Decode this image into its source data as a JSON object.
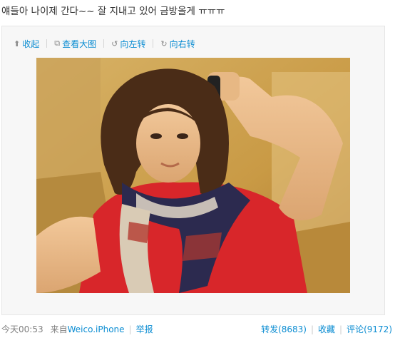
{
  "post": {
    "text": "얘들아 나이제 간다~~ 잘 지내고 있어 금방올게 ㅠㅠㅠ"
  },
  "toolbar": {
    "collapse_label": "收起",
    "view_large_label": "查看大图",
    "rotate_left_label": "向左转",
    "rotate_right_label": "向右转"
  },
  "footer": {
    "time": "今天00:53",
    "source_prefix": "来自",
    "source_app": "Weico.iPhone",
    "report_label": "举报",
    "repost_label": "转发(8683)",
    "favorite_label": "收藏",
    "comment_label": "评论(9172)"
  },
  "icons": {
    "collapse": "arrow-up-icon",
    "view_large": "external-link-icon",
    "rotate_left": "rotate-left-icon",
    "rotate_right": "rotate-right-icon"
  },
  "colors": {
    "link": "#0a8cd2",
    "meta": "#808080"
  }
}
